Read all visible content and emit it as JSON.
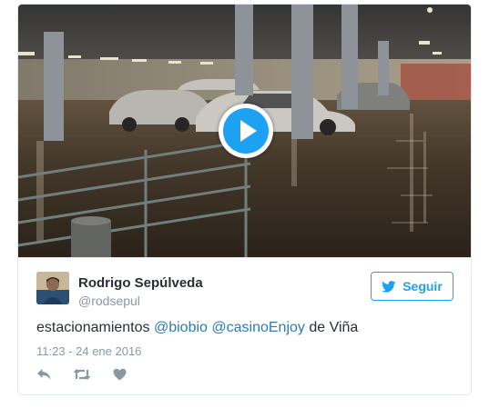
{
  "media": {
    "type": "video",
    "play_icon": "play-icon"
  },
  "author": {
    "name": "Rodrigo Sepúlveda",
    "handle": "@rodsepul"
  },
  "follow": {
    "label": "Seguir",
    "icon": "twitter-bird-icon"
  },
  "tweet": {
    "text_before": "estacionamientos ",
    "mention_1": "@biobio",
    "space": " ",
    "mention_2": "@casinoEnjoy",
    "text_after": " de Viña",
    "timestamp": "11:23 - 24 ene 2016"
  },
  "actions": [
    "reply-icon",
    "retweet-icon",
    "like-icon"
  ],
  "colors": {
    "accent": "#1da1f2",
    "link": "#2b7bb9",
    "muted": "#8899a6",
    "text": "#292f33",
    "border": "#e1e8ed"
  }
}
